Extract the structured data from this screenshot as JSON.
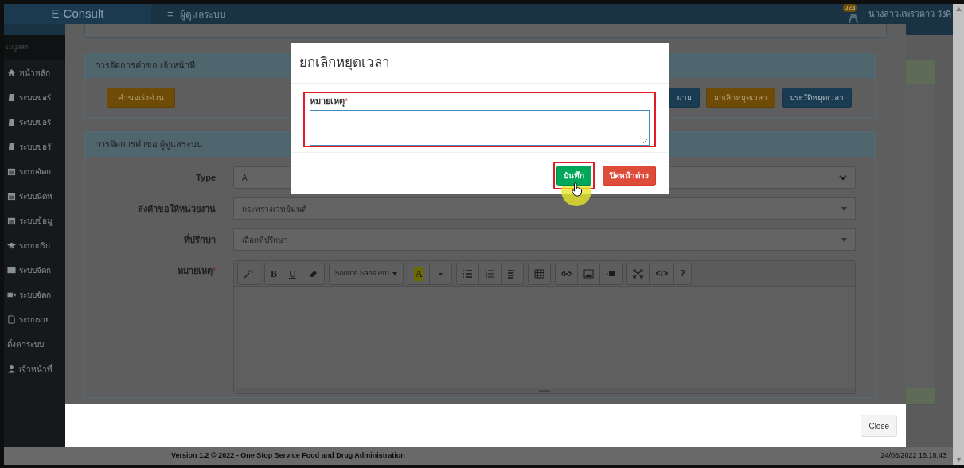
{
  "header": {
    "logo": "E-Consult",
    "menu_icon": "≡",
    "title": "ผู้ดูแลระบบ",
    "badge": "023",
    "user": "นางสาวแพรวดาว วังคี"
  },
  "sidebar": {
    "heading": "เมนูหลัก",
    "items": [
      {
        "kind": "home",
        "label": "หน้าหลัก"
      },
      {
        "kind": "book",
        "label": "ระบบขอรั"
      },
      {
        "kind": "book",
        "label": "ระบบขอรั"
      },
      {
        "kind": "book",
        "label": "ระบบขอรั"
      },
      {
        "kind": "calendar",
        "label": "ระบบจัดก"
      },
      {
        "kind": "calendar",
        "label": "ระบบนัดห"
      },
      {
        "kind": "calendar",
        "label": "ระบบข้อมู"
      },
      {
        "kind": "cap",
        "label": "ระบบบริก"
      },
      {
        "kind": "card",
        "label": "ระบบจัดก"
      },
      {
        "kind": "video",
        "label": "ระบบจัดก"
      },
      {
        "kind": "file",
        "label": "ระบบราย"
      },
      {
        "kind": "section",
        "label": "ตั้งค่าระบบ"
      },
      {
        "kind": "user",
        "label": "เจ้าหน้าที่"
      }
    ]
  },
  "footer": {
    "version": "Version 1.2 © 2022 - One Stop Service Food and Drug Administration",
    "datetime": "24/08/2022 16:18:43"
  },
  "dialog": {
    "staff_panel": {
      "title": "การจัดการคำขอ เจ้าหน้าที่",
      "left_buttons": [
        {
          "label": "คำขอเร่งด่วน",
          "kind": "warning"
        }
      ],
      "right_buttons": [
        {
          "label": "มาย",
          "kind": "primary"
        },
        {
          "label": "ยกเลิกหยุดเวลา",
          "kind": "warning"
        },
        {
          "label": "ประวัติหยุดเวลา",
          "kind": "primary"
        }
      ]
    },
    "admin_panel": {
      "title": "การจัดการคำขอ ผู้ดูแลระบบ",
      "fields": [
        {
          "label": "Type",
          "value": "A",
          "kind": "select"
        },
        {
          "label": "ส่งคำขอให้หน่วยงาน",
          "value": "กระทรวงเวทย์มนต์",
          "kind": "select2"
        },
        {
          "label": "ที่ปรึกษา",
          "value": "เลือกที่ปรึกษา",
          "kind": "select2"
        }
      ],
      "note": {
        "label": "หมายเหตุ",
        "required_mark": "*",
        "toolbar": [
          [
            {
              "kind": "wand"
            }
          ],
          [
            {
              "kind": "bold",
              "label": "B"
            },
            {
              "kind": "underline",
              "label": "U"
            },
            {
              "kind": "eraser"
            }
          ],
          [
            {
              "kind": "font",
              "label": "Source Sans Pro"
            }
          ],
          [
            {
              "kind": "color",
              "label": "A"
            },
            {
              "kind": "caret"
            }
          ],
          [
            {
              "kind": "ul"
            },
            {
              "kind": "ol"
            },
            {
              "kind": "align"
            }
          ],
          [
            {
              "kind": "table"
            }
          ],
          [
            {
              "kind": "link"
            },
            {
              "kind": "picture"
            },
            {
              "kind": "video"
            }
          ],
          [
            {
              "kind": "fullscreen"
            },
            {
              "kind": "text",
              "label": "</>"
            },
            {
              "kind": "text",
              "label": "?"
            }
          ]
        ]
      }
    },
    "close_button": "Close"
  },
  "modal": {
    "title": "ยกเลิกหยุดเวลา",
    "field": {
      "label": "หมายเหตุ",
      "required_mark": "*",
      "focused": true,
      "highlighted": true
    },
    "buttons": [
      {
        "label": "บันทึก",
        "kind": "success",
        "highlighted": true
      },
      {
        "label": "ปิดหน้าต่าง",
        "kind": "danger",
        "highlighted": false
      }
    ]
  }
}
